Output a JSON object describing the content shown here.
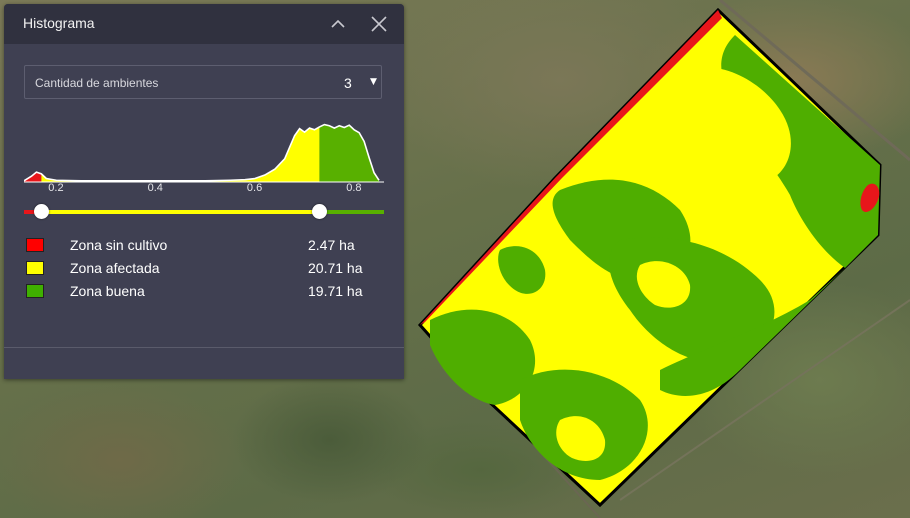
{
  "panel": {
    "title": "Histograma",
    "collapse_icon": "chevron-up-icon",
    "close_icon": "close-icon"
  },
  "select": {
    "label": "Cantidad de ambientes",
    "value": "3"
  },
  "histogram": {
    "ticks": [
      "0.2",
      "0.4",
      "0.6",
      "0.8"
    ],
    "xlim": [
      0.135,
      0.86
    ],
    "breakpoints": [
      0.17,
      0.73
    ],
    "profile_x": [
      0.135,
      0.15,
      0.16,
      0.17,
      0.18,
      0.2,
      0.25,
      0.3,
      0.4,
      0.5,
      0.55,
      0.58,
      0.6,
      0.62,
      0.64,
      0.66,
      0.67,
      0.68,
      0.69,
      0.7,
      0.71,
      0.72,
      0.73,
      0.74,
      0.75,
      0.76,
      0.77,
      0.78,
      0.79,
      0.8,
      0.81,
      0.82,
      0.83,
      0.84,
      0.85
    ],
    "profile_y": [
      0.02,
      0.1,
      0.17,
      0.14,
      0.06,
      0.03,
      0.02,
      0.02,
      0.02,
      0.02,
      0.03,
      0.04,
      0.06,
      0.12,
      0.22,
      0.4,
      0.6,
      0.8,
      0.92,
      0.86,
      0.93,
      0.9,
      0.95,
      0.99,
      0.97,
      0.93,
      0.97,
      0.94,
      0.98,
      0.9,
      0.85,
      0.7,
      0.42,
      0.16,
      0.03
    ],
    "colors": {
      "red": "#e8161b",
      "yellow": "#ffff00",
      "green": "#58b000"
    }
  },
  "legend": [
    {
      "name": "Zona sin cultivo",
      "area": "2.47 ha",
      "color": "#ff0000"
    },
    {
      "name": "Zona afectada",
      "area": "20.71 ha",
      "color": "#ffff00"
    },
    {
      "name": "Zona buena",
      "area": "19.71 ha",
      "color": "#3fb000"
    }
  ]
}
